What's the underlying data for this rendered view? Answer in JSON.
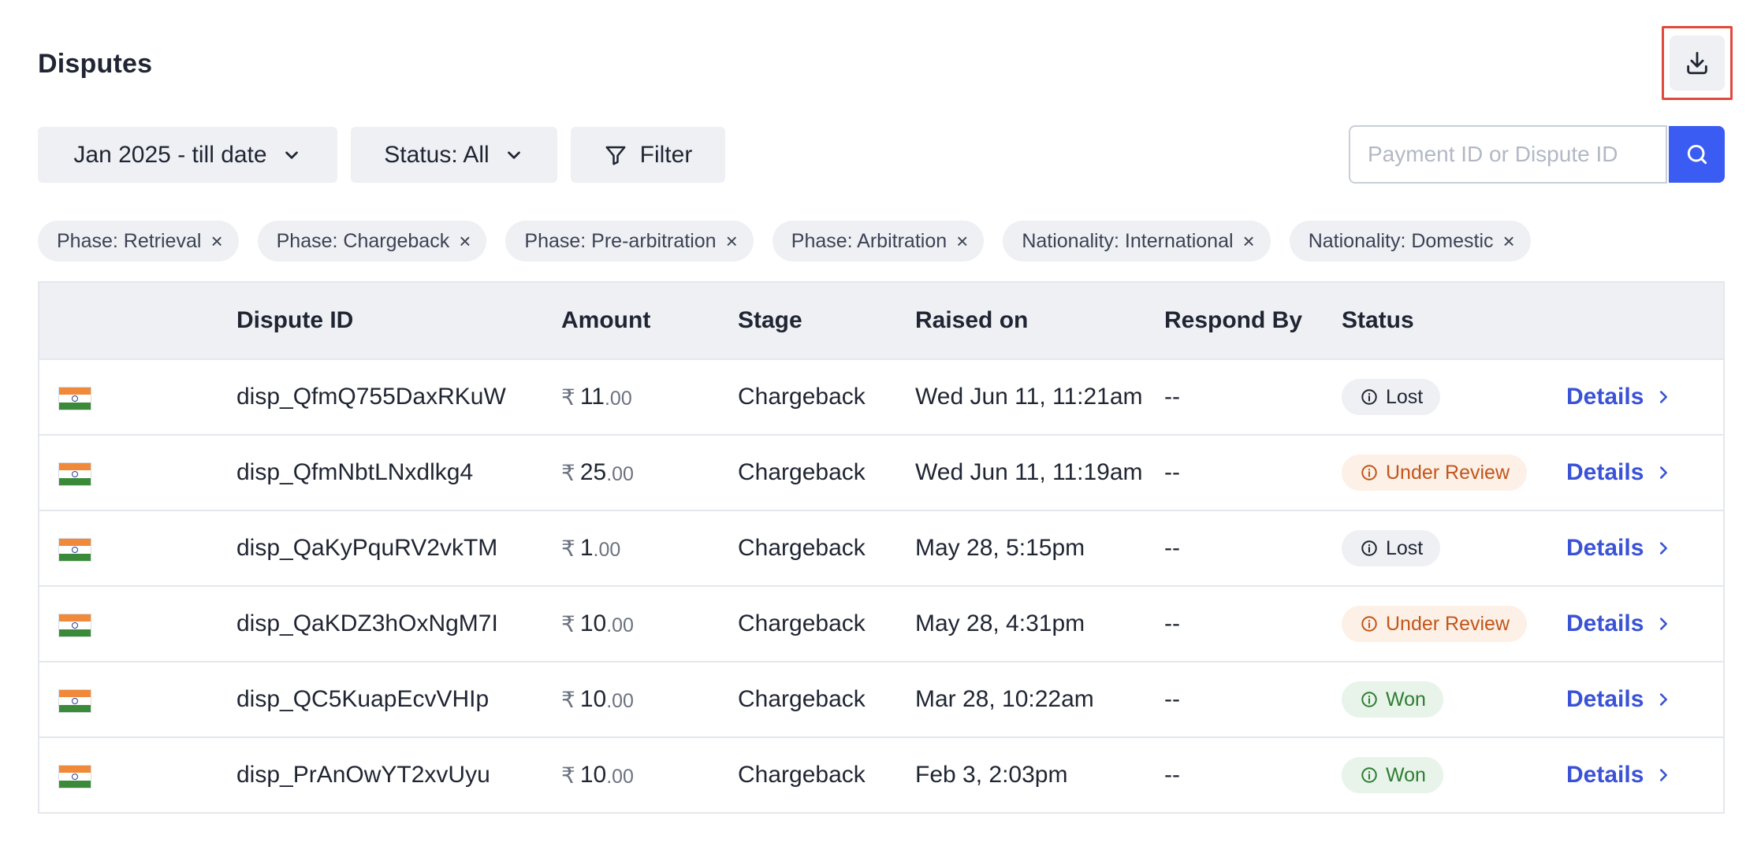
{
  "page": {
    "title": "Disputes"
  },
  "toolbar": {
    "download_icon": "download-icon",
    "date_range": "Jan 2025 - till date",
    "status": "Status: All",
    "filter": "Filter",
    "search_placeholder": "Payment ID or Dispute ID",
    "search_value": ""
  },
  "chips": [
    {
      "label": "Phase: Retrieval"
    },
    {
      "label": "Phase: Chargeback"
    },
    {
      "label": "Phase: Pre-arbitration"
    },
    {
      "label": "Phase: Arbitration"
    },
    {
      "label": "Nationality: International"
    },
    {
      "label": "Nationality: Domestic"
    }
  ],
  "table": {
    "headers": [
      "Dispute ID",
      "Amount",
      "Stage",
      "Raised on",
      "Respond By",
      "Status"
    ],
    "rows": [
      {
        "flag": "india-flag",
        "dispute_id": "disp_QfmQ755DaxRKuW",
        "currency": "₹",
        "amount_int": "11",
        "amount_dec": ".00",
        "stage": "Chargeback",
        "raised_on": "Wed Jun 11, 11:21am",
        "respond_by": "--",
        "status": "Lost",
        "status_type": "lost",
        "action": "Details"
      },
      {
        "flag": "india-flag",
        "dispute_id": "disp_QfmNbtLNxdlkg4",
        "currency": "₹",
        "amount_int": "25",
        "amount_dec": ".00",
        "stage": "Chargeback",
        "raised_on": "Wed Jun 11, 11:19am",
        "respond_by": "--",
        "status": "Under Review",
        "status_type": "review",
        "action": "Details"
      },
      {
        "flag": "india-flag",
        "dispute_id": "disp_QaKyPquRV2vkTM",
        "currency": "₹",
        "amount_int": "1",
        "amount_dec": ".00",
        "stage": "Chargeback",
        "raised_on": "May 28, 5:15pm",
        "respond_by": "--",
        "status": "Lost",
        "status_type": "lost",
        "action": "Details"
      },
      {
        "flag": "india-flag",
        "dispute_id": "disp_QaKDZ3hOxNgM7I",
        "currency": "₹",
        "amount_int": "10",
        "amount_dec": ".00",
        "stage": "Chargeback",
        "raised_on": "May 28, 4:31pm",
        "respond_by": "--",
        "status": "Under Review",
        "status_type": "review",
        "action": "Details"
      },
      {
        "flag": "india-flag",
        "dispute_id": "disp_QC5KuapEcvVHIp",
        "currency": "₹",
        "amount_int": "10",
        "amount_dec": ".00",
        "stage": "Chargeback",
        "raised_on": "Mar 28, 10:22am",
        "respond_by": "--",
        "status": "Won",
        "status_type": "won",
        "action": "Details"
      },
      {
        "flag": "india-flag",
        "dispute_id": "disp_PrAnOwYT2xvUyu",
        "currency": "₹",
        "amount_int": "10",
        "amount_dec": ".00",
        "stage": "Chargeback",
        "raised_on": "Feb 3, 2:03pm",
        "respond_by": "--",
        "status": "Won",
        "status_type": "won",
        "action": "Details"
      }
    ]
  },
  "colors": {
    "accent": "#3a5cf2",
    "link": "#3a52d6",
    "lost": "#1f2532",
    "under_review": "#c2561b",
    "won": "#2e7d32",
    "highlight_border": "#e04a3c"
  }
}
